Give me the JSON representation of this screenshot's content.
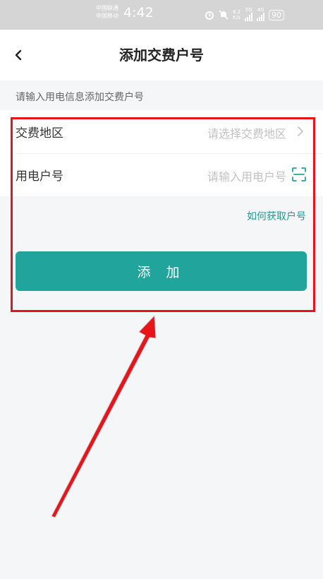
{
  "status_bar": {
    "carrier_1": "中国联通",
    "carrier_2": "中国移动",
    "time": "4:42",
    "speed_value": "8.2",
    "speed_unit": "K/s",
    "network_1": "5G",
    "network_2": "4G",
    "battery": "90",
    "icons": [
      "alarm-icon",
      "mute-icon",
      "signal-icon",
      "battery-icon"
    ]
  },
  "header": {
    "title": "添加交费户号",
    "back_icon": "chevron-left-icon"
  },
  "hint": "请输入用电信息添加交费户号",
  "form": {
    "region": {
      "label": "交费地区",
      "placeholder": "请选择交费地区",
      "icon": "chevron-right-icon"
    },
    "account": {
      "label": "用电户号",
      "placeholder": "请输入用电户号",
      "icon": "scan-icon"
    }
  },
  "help_link": "如何获取户号",
  "add_button": "添 加",
  "colors": {
    "accent": "#20a49b",
    "link": "#1a9e94",
    "annotation": "#e8141c",
    "background": "#f5f6f7"
  }
}
